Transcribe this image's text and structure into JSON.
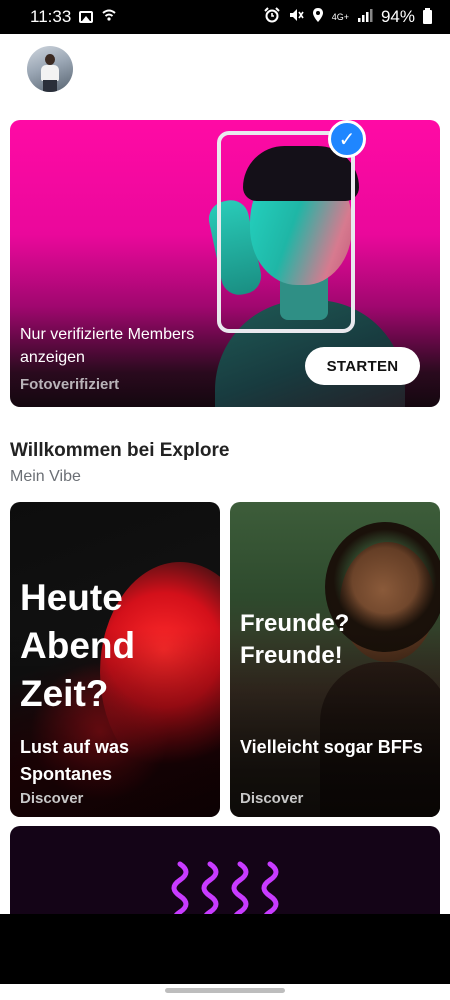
{
  "status_bar": {
    "time": "11:33",
    "network": "4G+",
    "battery": "94%"
  },
  "verify_card": {
    "text": "Nur verifizierte Members anzeigen",
    "subtext": "Fotoverifiziert",
    "button_label": "STARTEN"
  },
  "section": {
    "title": "Willkommen bei Explore",
    "subtitle": "Mein Vibe"
  },
  "tiles": [
    {
      "big_text": "Heute Abend Zeit?",
      "caption": "Lust auf was Spontanes",
      "category": "Discover"
    },
    {
      "big_text": "Freunde? Freunde!",
      "caption": "Vielleicht sogar BFFs",
      "category": "Discover"
    }
  ],
  "bottom_nav": {
    "items": [
      {
        "icon": "flame-icon",
        "active": false
      },
      {
        "icon": "explore-icon",
        "active": true
      },
      {
        "icon": "sparkle-icon",
        "active": false
      },
      {
        "icon": "chat-icon",
        "active": false
      }
    ]
  },
  "colors": {
    "accent": "#fd3e5c",
    "nav_inactive": "#c9cdd3",
    "verified_blue": "#1f86ff",
    "card_pink": "#ff0aa5"
  }
}
